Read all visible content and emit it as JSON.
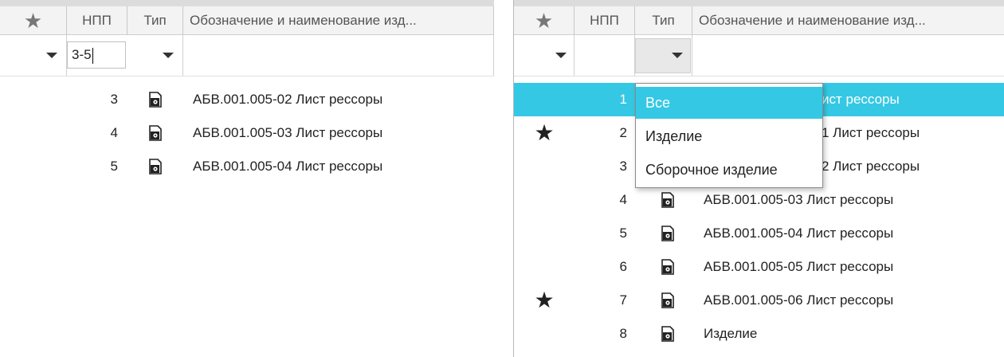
{
  "columns": {
    "star_header": "★",
    "npp": "НПП",
    "type": "Тип",
    "name": "Обозначение и наименование изд..."
  },
  "left_panel": {
    "npp_filter_value": "3-5",
    "rows": [
      {
        "num": "3",
        "name": "АБВ.001.005-02 Лист рессоры"
      },
      {
        "num": "4",
        "name": "АБВ.001.005-03 Лист рессоры"
      },
      {
        "num": "5",
        "name": "АБВ.001.005-04 Лист рессоры"
      }
    ]
  },
  "right_panel": {
    "rows": [
      {
        "num": "1",
        "star": "",
        "name": "ист рессоры"
      },
      {
        "num": "2",
        "star": "★",
        "name": "1 Лист рессоры"
      },
      {
        "num": "3",
        "star": "",
        "name": "2 Лист рессоры"
      },
      {
        "num": "4",
        "star": "",
        "name": "АБВ.001.005-03 Лист рессоры"
      },
      {
        "num": "5",
        "star": "",
        "name": "АБВ.001.005-04 Лист рессоры"
      },
      {
        "num": "6",
        "star": "",
        "name": "АБВ.001.005-05 Лист рессоры"
      },
      {
        "num": "7",
        "star": "★",
        "name": "АБВ.001.005-06 Лист рессоры"
      },
      {
        "num": "8",
        "star": "",
        "name": "Изделие"
      }
    ],
    "type_dropdown": {
      "options": [
        "Все",
        "Изделие",
        "Сборочное изделие"
      ],
      "highlighted": "Все"
    }
  },
  "icons": {
    "type_icon": "assembly-document-icon",
    "star": "star-icon"
  },
  "colors": {
    "selection": "#35c8e4",
    "header_bg": "#f3f3f3"
  }
}
